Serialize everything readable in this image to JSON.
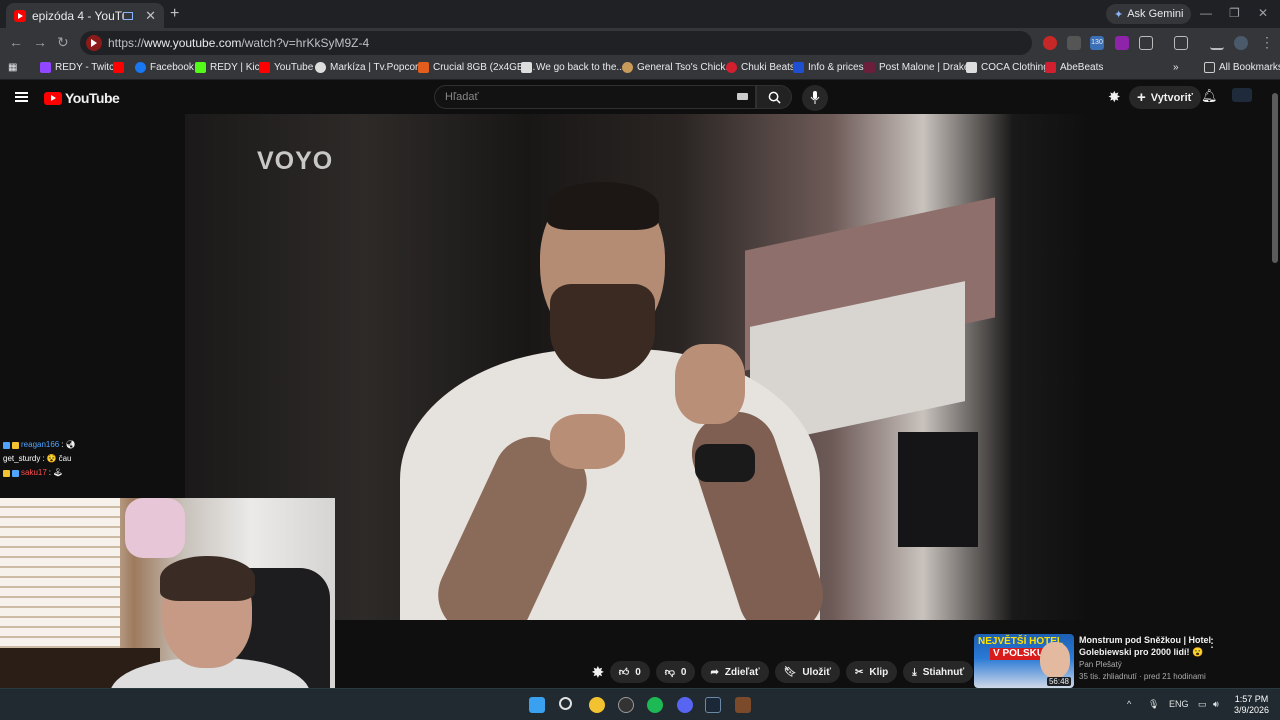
{
  "browser": {
    "tab_title": "epizóda 4 - YouTube",
    "new_tab": "+",
    "gemini_label": "Ask Gemini",
    "url_prefix": "https://",
    "url_host": "www.youtube.com",
    "url_path": "/watch?v=hrKkSyM9Z-4",
    "extension_badge": "130",
    "all_bookmarks": "All Bookmarks",
    "bookmarks": [
      {
        "label": "REDY - Twitch",
        "color": "#9146ff"
      },
      {
        "label": "",
        "color": "#ff0000"
      },
      {
        "label": "Facebook",
        "color": "#1877f2"
      },
      {
        "label": "REDY | Kick",
        "color": "#53fc18"
      },
      {
        "label": "YouTube",
        "color": "#ff0000"
      },
      {
        "label": "Markíza | Tv.Popcor...",
        "color": "#dddddd"
      },
      {
        "label": "Crucial 8GB (2x4GB)...",
        "color": "#e35d1c"
      },
      {
        "label": "We go back to the...",
        "color": "#dddddd"
      },
      {
        "label": "General Tso's Chick...",
        "color": "#c89b5a"
      },
      {
        "label": "Chuki Beats",
        "color": "#d11f2f"
      },
      {
        "label": "Info & prices",
        "color": "#1f4fd1"
      },
      {
        "label": "Post Malone | Drake...",
        "color": "#6a1f3a"
      },
      {
        "label": "COCA Clothing",
        "color": "#dddddd"
      },
      {
        "label": "AbeBeats",
        "color": "#d11f2f"
      }
    ]
  },
  "youtube": {
    "logo_text": "YouTube",
    "search_placeholder": "Hľadať",
    "create_label": "Vytvoriť"
  },
  "video": {
    "watermark": "VOYO"
  },
  "chat": [
    {
      "user": "reagan166",
      "color": "#4fa3ff",
      "msg": ""
    },
    {
      "user": "get_sturdy",
      "color": "#ffffff",
      "msg": "čau"
    },
    {
      "user": "saku17",
      "color": "#ff4f4f",
      "msg": ""
    }
  ],
  "actions": {
    "likes": "0",
    "dislikes": "0",
    "share": "Zdieľať",
    "save": "Uložiť",
    "clip": "Klip",
    "download": "Stiahnuť"
  },
  "suggestion": {
    "title": "Monstrum pod Sněžkou | Hotel Golebiewski pro 2000 lidí!",
    "channel": "Pan Plešatý",
    "meta": "35 tis. zhliadnutí · pred 21 hodinami",
    "thumb_line1": "NEJVĚTŠÍ HOTEL",
    "thumb_line2": "V POLSKU",
    "duration": "56:48"
  },
  "taskbar": {
    "lang": "ENG",
    "time": "1:57 PM",
    "date": "3/9/2026",
    "apps": [
      {
        "name": "windows-start",
        "color": "#3aa0f0"
      },
      {
        "name": "search",
        "color": "#e0e0e0"
      },
      {
        "name": "chrome",
        "color": "#f2c230"
      },
      {
        "name": "obs",
        "color": "#333333"
      },
      {
        "name": "spotify",
        "color": "#1db954"
      },
      {
        "name": "discord",
        "color": "#5865f2"
      },
      {
        "name": "steam",
        "color": "#1b2838"
      },
      {
        "name": "game",
        "color": "#7a4a2a"
      }
    ]
  }
}
